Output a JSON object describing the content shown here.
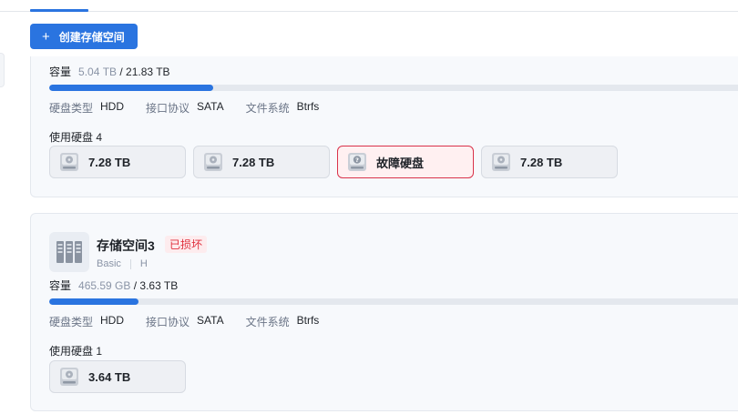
{
  "create_button": {
    "plus": "+",
    "label": "创建存储空间"
  },
  "pools": [
    {
      "capacity": {
        "label": "容量",
        "used": "5.04 TB",
        "total": "/ 21.83 TB",
        "fraction": 0.2309
      },
      "meta": [
        {
          "key": "硬盘类型",
          "value": "HDD"
        },
        {
          "key": "接口协议",
          "value": "SATA"
        },
        {
          "key": "文件系统",
          "value": "Btrfs"
        }
      ],
      "disk_count_label": "使用硬盘 4",
      "disks": [
        {
          "label": "7.28 TB",
          "status": "normal"
        },
        {
          "label": "7.28 TB",
          "status": "normal"
        },
        {
          "label": "故障硬盘",
          "status": "fault"
        },
        {
          "label": "7.28 TB",
          "status": "normal"
        }
      ]
    },
    {
      "name": "存储空间3",
      "status_badge": "已损坏",
      "raid": "Basic",
      "volume": "H",
      "capacity": {
        "label": "容量",
        "used": "465.59 GB",
        "total": "/ 3.63 TB",
        "fraction": 0.1253
      },
      "meta": [
        {
          "key": "硬盘类型",
          "value": "HDD"
        },
        {
          "key": "接口协议",
          "value": "SATA"
        },
        {
          "key": "文件系统",
          "value": "Btrfs"
        }
      ],
      "disk_count_label": "使用硬盘 1",
      "disks": [
        {
          "label": "3.64 TB",
          "status": "normal"
        }
      ]
    }
  ],
  "colors": {
    "accent": "#2a74e0",
    "danger": "#e0303e"
  }
}
